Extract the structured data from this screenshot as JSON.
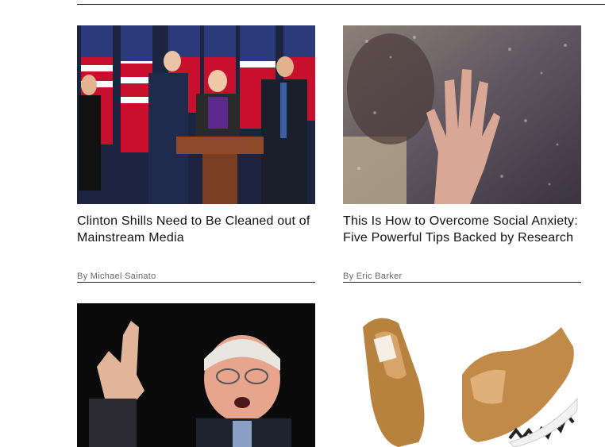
{
  "articles": [
    {
      "headline": "Clinton Shills Need to Be Cleaned out of Mainstream Media",
      "byline_prefix": "By",
      "author": "Michael Sainato"
    },
    {
      "headline": "This Is How to Overcome Social Anxiety: Five Powerful Tips Backed by Research",
      "byline_prefix": "By",
      "author": "Eric Barker"
    },
    {
      "headline": "",
      "byline_prefix": "",
      "author": ""
    },
    {
      "headline": "",
      "byline_prefix": "",
      "author": ""
    }
  ],
  "colors": {
    "text": "#111111",
    "byline": "#666666",
    "rule": "#222222"
  }
}
